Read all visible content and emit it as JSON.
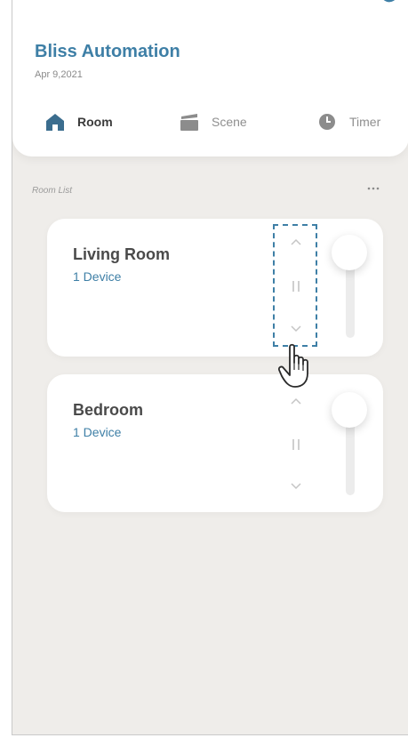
{
  "header": {
    "title": "Bliss Automation",
    "date": "Apr 9,2021"
  },
  "tabs": [
    {
      "label": "Room",
      "icon": "home-icon",
      "active": true
    },
    {
      "label": "Scene",
      "icon": "scene-icon",
      "active": false
    },
    {
      "label": "Timer",
      "icon": "clock-icon",
      "active": false
    }
  ],
  "room_list": {
    "label": "Room List",
    "more_icon": "more-icon"
  },
  "rooms": [
    {
      "name": "Living Room",
      "devices": "1 Device"
    },
    {
      "name": "Bedroom",
      "devices": "1 Device"
    }
  ],
  "colors": {
    "accent": "#3e7fa6",
    "background": "#efedea",
    "card": "#ffffff",
    "active_tab_icon": "#3b6d8e"
  }
}
